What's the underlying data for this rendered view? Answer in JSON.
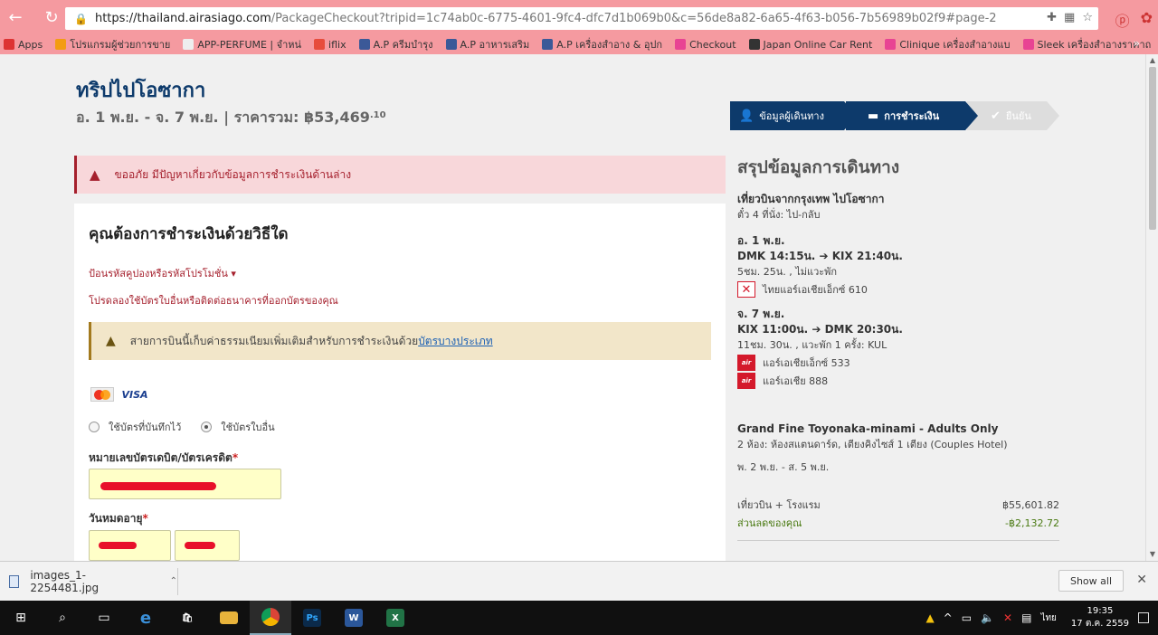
{
  "browser": {
    "url_host": "https://thailand.airasiago.com",
    "url_rest": "/PackageCheckout?tripid=1c74ab0c-6775-4601-9fc4-dfc7d1b069b0&c=56de8a82-6a65-4f63-b056-7b56989b02f9#page-2",
    "bookmarks": [
      "Apps",
      "โปรแกรมผู้ช่วยการขาย",
      "APP-PERFUME | จำหน่",
      "iflix",
      "A.P ครีมบำรุง",
      "A.P อาหารเสริม",
      "A.P เครื่องสำอาง & อุปก",
      "Checkout",
      "Japan Online Car Rent",
      "Clinique เครื่องสำอางแบ",
      "Sleek เครื่องสำอางราคาถ"
    ],
    "bookmarks_more": "»"
  },
  "trip": {
    "title": "ทริปไปโอซากา",
    "subtitle": "อ. 1 พ.ย. - จ. 7 พ.ย. | ราคารวม: ฿53,469",
    "cents": ".10"
  },
  "steps": [
    {
      "label": "ข้อมูลผู้เดินทาง",
      "icon": "👤"
    },
    {
      "label": "การชำระเงิน",
      "icon": "▬"
    },
    {
      "label": "ยืนยัน",
      "icon": "✔"
    }
  ],
  "error_alert": "ขออภัย มีปัญหาเกี่ยวกับข้อมูลการชำระเงินด้านล่าง",
  "payment": {
    "heading": "คุณต้องการชำระเงินด้วยวิธีใด",
    "promo_link": "ป้อนรหัสคูปองหรือรหัสโปรโมชั่น ▾",
    "try_other": "โปรดลองใช้บัตรใบอื่นหรือติดต่อธนาคารที่ออกบัตรของคุณ",
    "fee_text": "สายการบินนี้เก็บค่าธรรมเนียมเพิ่มเติมสำหรับการชำระเงินด้วย",
    "fee_link": "บัตรบางประเภท",
    "card_mastercard": "MasterCard",
    "card_visa": "VISA",
    "radio_saved": "ใช้บัตรที่บันทึกไว้",
    "radio_other": "ใช้บัตรใบอื่น",
    "card_number_label": "หมายเลขบัตรเดบิต/บัตรเครดิต",
    "expiry_label": "วันหมดอายุ",
    "required_mark": "*"
  },
  "summary": {
    "title": "สรุปข้อมูลการเดินทาง",
    "flight_title": "เที่ยวบินจากกรุงเทพ ไปโอซากา",
    "flight_sub": "ตั๋ว 4 ที่นั่ง: ไป-กลับ",
    "outbound": {
      "date": "อ. 1 พ.ย.",
      "route": "DMK 14:15น. ➔ KIX 21:40น.",
      "duration": "5ชม. 25น. , ไม่แวะพัก",
      "airlines": [
        {
          "name": "ไทยแอร์เอเชียเอ็กซ์ 610",
          "logo": "cross"
        }
      ]
    },
    "inbound": {
      "date": "จ. 7 พ.ย.",
      "route": "KIX 11:00น. ➔ DMK 20:30น.",
      "duration": "11ชม. 30น. , แวะพัก 1 ครั้ง: KUL",
      "airlines": [
        {
          "name": "แอร์เอเชียเอ็กซ์ 533",
          "logo": "red"
        },
        {
          "name": "แอร์เอเชีย 888",
          "logo": "red"
        }
      ]
    },
    "hotel_name": "Grand Fine Toyonaka-minami - Adults Only",
    "hotel_rooms": "2 ห้อง: ห้องสแตนดาร์ด, เตียงคิงไซส์ 1 เตียง (Couples Hotel)",
    "hotel_dates": "พ. 2 พ.ย. - ส. 5 พ.ย.",
    "price_label": "เที่ยวบิน + โรงแรม",
    "price_value": "฿55,601.82",
    "discount_label": "ส่วนลดของคุณ",
    "discount_value": "-฿2,132.72"
  },
  "download": {
    "file_name": "images_1-2254481.jpg",
    "show_all": "Show all"
  },
  "taskbar": {
    "time": "19:35",
    "date": "17 ต.ค. 2559",
    "lang": "ไทย"
  }
}
